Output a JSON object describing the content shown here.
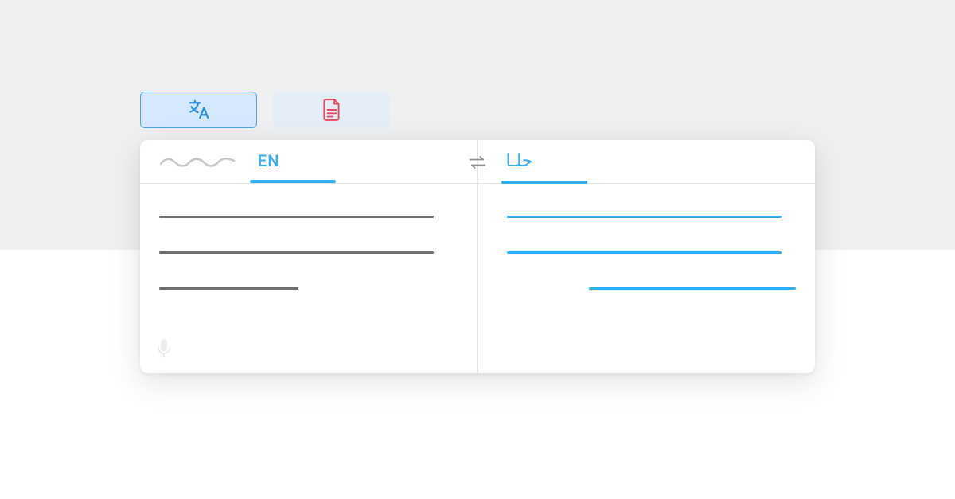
{
  "tabs": {
    "translate_icon": "translate-icon",
    "document_icon": "document-icon"
  },
  "source": {
    "detected_label": "EN"
  },
  "target": {
    "label": "حلـا"
  },
  "colors": {
    "accent": "#33aef2",
    "doc_icon": "#e84a5f",
    "text_line": "#6d6f72"
  }
}
